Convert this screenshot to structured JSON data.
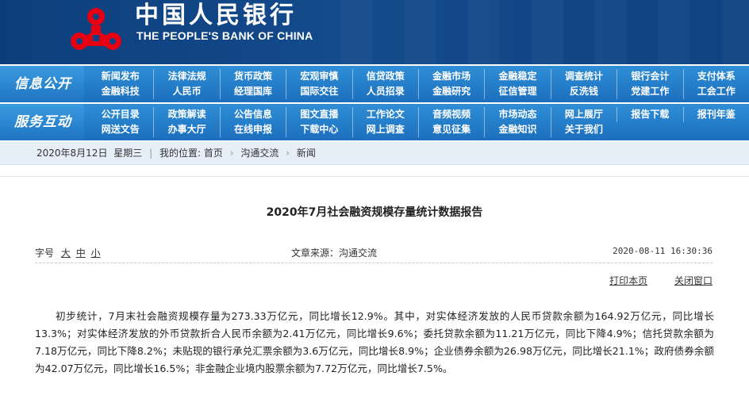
{
  "header": {
    "logo_cn": "中国人民银行",
    "logo_en": "THE PEOPLE'S BANK OF CHINA",
    "brand_red": "#e60012",
    "brand_blue": "#0f4282"
  },
  "nav_info": {
    "label": "信息公开",
    "items": [
      "新闻发布",
      "法律法规",
      "货币政策",
      "宏观审慎",
      "信贷政策",
      "金融市场",
      "金融稳定",
      "调查统计",
      "银行会计",
      "支付体系",
      "金融科技",
      "人民币",
      "经理国库",
      "国际交往",
      "人员招录",
      "金融研究",
      "征信管理",
      "反洗钱",
      "党建工作",
      "工会工作"
    ]
  },
  "nav_service": {
    "label": "服务互动",
    "items": [
      "公开目录",
      "政策解读",
      "公告信息",
      "图文直播",
      "工作论文",
      "音频视频",
      "市场动态",
      "网上展厅",
      "报告下载",
      "报刊年鉴",
      "网送文告",
      "办事大厅",
      "在线申报",
      "下载中心",
      "网上调查",
      "意见征集",
      "金融知识",
      "关于我们"
    ]
  },
  "crumbbar": {
    "date": "2020年8月12日",
    "weekday": "星期三",
    "location_label": "我的位置:",
    "crumbs": [
      "首页",
      "沟通交流",
      "新闻"
    ]
  },
  "article": {
    "title": "2020年7月社会融资规模存量统计数据报告",
    "fontsize_label": "字号",
    "fontsize_options": [
      "大",
      "中",
      "小"
    ],
    "source": "文章来源：沟通交流",
    "datetime": "2020-08-11 16:30:36",
    "print_label": "打印本页",
    "close_label": "关闭窗口",
    "body": "初步统计，7月末社会融资规模存量为273.33万亿元，同比增长12.9%。其中，对实体经济发放的人民币贷款余额为164.92万亿元，同比增长13.3%；对实体经济发放的外币贷款折合人民币余额为2.41万亿元，同比增长9.6%；委托贷款余额为11.21万亿元，同比下降4.9%；信托贷款余额为7.18万亿元，同比下降8.2%；未贴现的银行承兑汇票余额为3.6万亿元，同比增长8.9%；企业债券余额为26.98万亿元，同比增长21.1%；政府债券余额为42.07万亿元，同比增长16.5%；非金融企业境内股票余额为7.72万亿元，同比增长7.5%。"
  }
}
